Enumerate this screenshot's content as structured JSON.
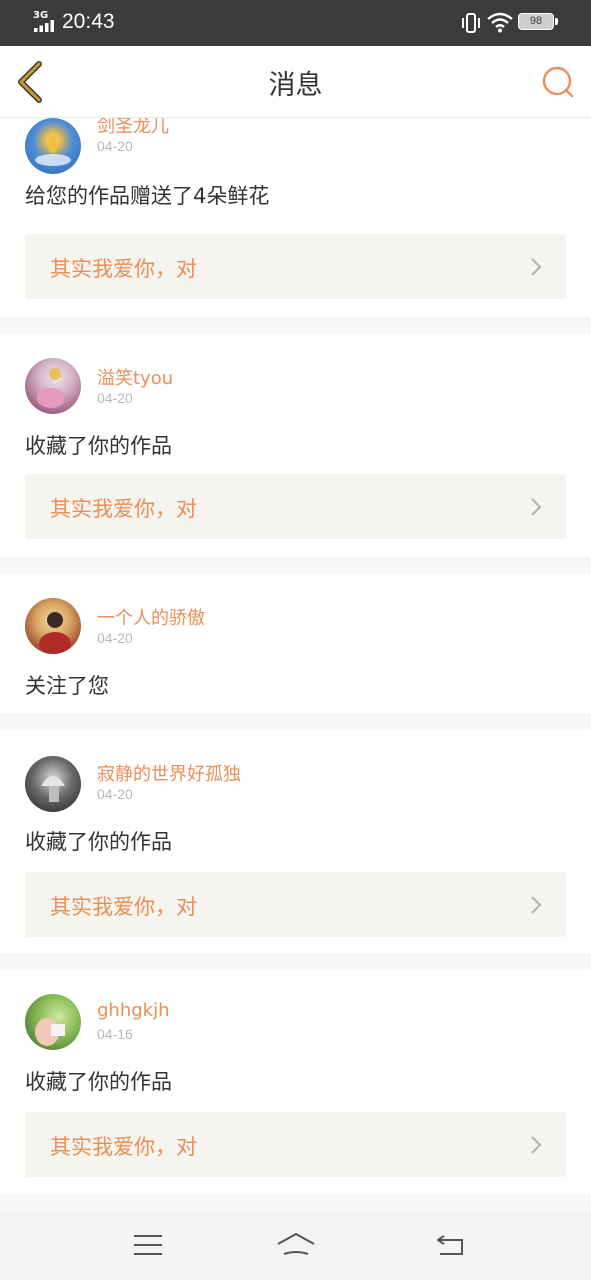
{
  "status_bar": {
    "network": "3G",
    "time": "20:43",
    "battery": "98"
  },
  "header": {
    "title": "消息",
    "back_icon": "chevron-left-icon",
    "search_icon": "search-icon"
  },
  "colors": {
    "accent": "#e98f58",
    "back_icon": "#c79a2c",
    "quote_bg": "#f5f4ee",
    "separator": "#f7f7f7"
  },
  "messages": [
    {
      "user": "剑圣龙儿",
      "date": "04-20",
      "action": "给您的作品赠送了4朵鲜花",
      "work_title": "其实我爱你，对"
    },
    {
      "user": "溢笑tyou",
      "date": "04-20",
      "action": "收藏了你的作品",
      "work_title": "其实我爱你，对"
    },
    {
      "user": "一个人的骄傲",
      "date": "04-20",
      "action": "关注了您"
    },
    {
      "user": "寂静的世界好孤独",
      "date": "04-20",
      "action": "收藏了你的作品",
      "work_title": "其实我爱你，对"
    },
    {
      "user": "ghhgkjh",
      "date": "04-16",
      "action": "收藏了你的作品",
      "work_title": "其实我爱你，对"
    }
  ],
  "nav_bar": {
    "menu_icon": "menu-icon",
    "home_icon": "home-icon",
    "back_icon": "return-icon"
  }
}
